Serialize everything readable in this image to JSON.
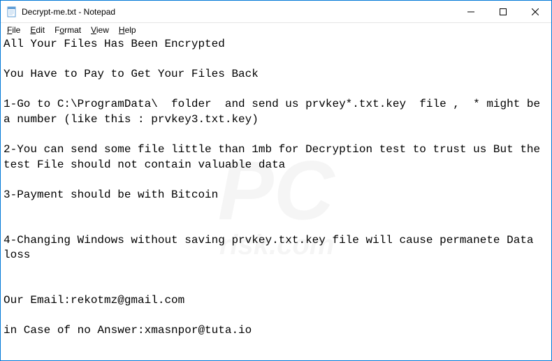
{
  "titlebar": {
    "title": "Decrypt-me.txt - Notepad"
  },
  "menubar": {
    "file": "File",
    "edit": "Edit",
    "format": "Format",
    "view": "View",
    "help": "Help"
  },
  "content": {
    "line1": "All Your Files Has Been Encrypted",
    "line2": "",
    "line3": "You Have to Pay to Get Your Files Back",
    "line4": "",
    "line5": "1-Go to C:\\ProgramData\\  folder  and send us prvkey*.txt.key  file ,  * might be a number (like this : prvkey3.txt.key)",
    "line6": "",
    "line7": "2-You can send some file little than 1mb for Decryption test to trust us But the test File should not contain valuable data",
    "line8": "",
    "line9": "3-Payment should be with Bitcoin",
    "line10": "",
    "line11": "",
    "line12": "4-Changing Windows without saving prvkey.txt.key file will cause permanete Data loss",
    "line13": "",
    "line14": "",
    "line15": "Our Email:rekotmz@gmail.com",
    "line16": "",
    "line17": "in Case of no Answer:xmasnpor@tuta.io"
  },
  "watermark": {
    "main": "PC",
    "sub": "risk.com"
  }
}
